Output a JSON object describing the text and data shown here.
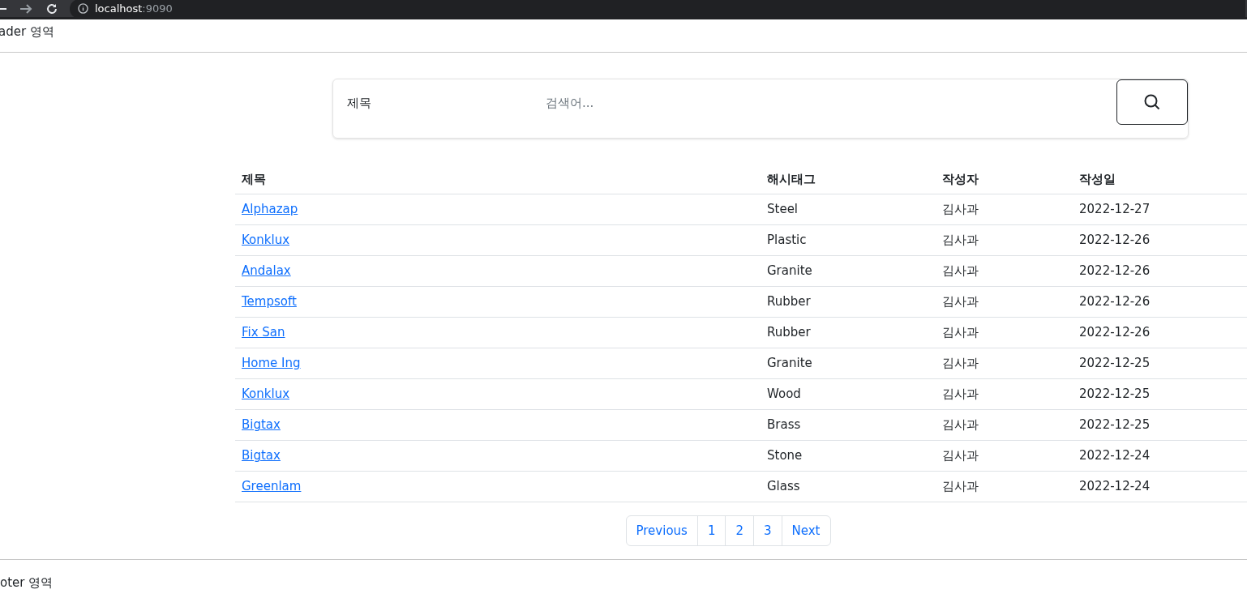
{
  "browser": {
    "host": "localhost",
    "port": ":9090"
  },
  "header": {
    "text": "ader 영역"
  },
  "search": {
    "type_label": "제목",
    "placeholder": "검색어..."
  },
  "table": {
    "columns": [
      "제목",
      "해시태그",
      "작성자",
      "작성일"
    ],
    "rows": [
      {
        "title": "Alphazap",
        "hashtag": "Steel",
        "author": "김사과",
        "date": "2022-12-27"
      },
      {
        "title": "Konklux",
        "hashtag": "Plastic",
        "author": "김사과",
        "date": "2022-12-26"
      },
      {
        "title": "Andalax",
        "hashtag": "Granite",
        "author": "김사과",
        "date": "2022-12-26"
      },
      {
        "title": "Tempsoft",
        "hashtag": "Rubber",
        "author": "김사과",
        "date": "2022-12-26"
      },
      {
        "title": "Fix San",
        "hashtag": "Rubber",
        "author": "김사과",
        "date": "2022-12-26"
      },
      {
        "title": "Home Ing",
        "hashtag": "Granite",
        "author": "김사과",
        "date": "2022-12-25"
      },
      {
        "title": "Konklux",
        "hashtag": "Wood",
        "author": "김사과",
        "date": "2022-12-25"
      },
      {
        "title": "Bigtax",
        "hashtag": "Brass",
        "author": "김사과",
        "date": "2022-12-25"
      },
      {
        "title": "Bigtax",
        "hashtag": "Stone",
        "author": "김사과",
        "date": "2022-12-24"
      },
      {
        "title": "Greenlam",
        "hashtag": "Glass",
        "author": "김사과",
        "date": "2022-12-24"
      }
    ]
  },
  "pagination": [
    "Previous",
    "1",
    "2",
    "3",
    "Next"
  ],
  "footer": {
    "text": "oter 영역"
  }
}
